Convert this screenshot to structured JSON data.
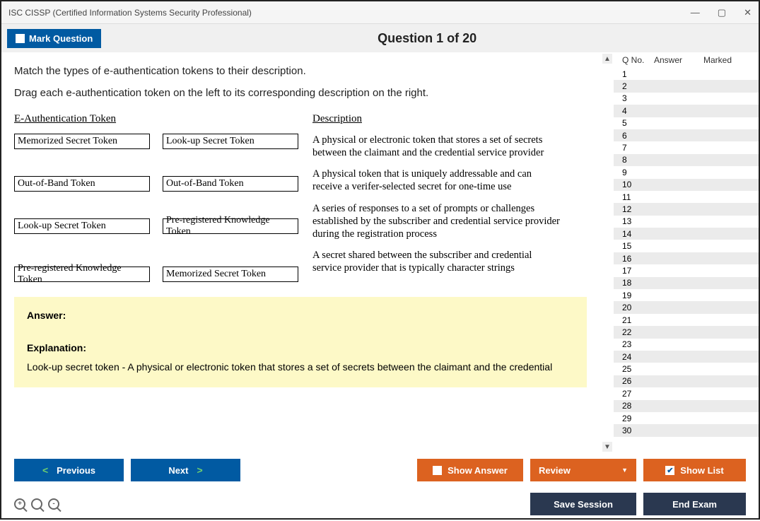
{
  "window": {
    "title": "ISC CISSP (Certified Information Systems Security Professional)"
  },
  "header": {
    "mark_label": "Mark Question",
    "question_title": "Question 1 of 20"
  },
  "prompt": {
    "line1": "Match the types of e-authentication tokens to their description.",
    "line2": "Drag each e-authentication token on the left to its corresponding description on the right."
  },
  "columns": {
    "left_head": "E-Authentication Token",
    "right_head": "Description"
  },
  "tokens_left": [
    "Memorized Secret Token",
    "Out-of-Band Token",
    "Look-up Secret Token",
    "Pre-registered Knowledge Token"
  ],
  "tokens_dropped": [
    "Look-up Secret Token",
    "Out-of-Band Token",
    "Pre-registered Knowledge Token",
    "Memorized Secret Token"
  ],
  "descriptions": [
    "A physical or electronic token that stores a set of secrets between the claimant and the credential service provider",
    "A physical token that is uniquely addressable and can receive a verifer-selected secret for one-time use",
    "A series of responses to a set of prompts or challenges established by the subscriber and credential service provider during the registration process",
    "A secret shared between the subscriber and credential service provider that is typically character strings"
  ],
  "answer_panel": {
    "answer_label": "Answer:",
    "explanation_label": "Explanation:",
    "explanation_text": "Look-up secret token - A physical or electronic token that stores a set of secrets between the claimant and the credential"
  },
  "qlist": {
    "head_qno": "Q No.",
    "head_answer": "Answer",
    "head_marked": "Marked",
    "rows": [
      1,
      2,
      3,
      4,
      5,
      6,
      7,
      8,
      9,
      10,
      11,
      12,
      13,
      14,
      15,
      16,
      17,
      18,
      19,
      20,
      21,
      22,
      23,
      24,
      25,
      26,
      27,
      28,
      29,
      30
    ]
  },
  "footer": {
    "previous": "Previous",
    "next": "Next",
    "show_answer": "Show Answer",
    "review": "Review",
    "show_list": "Show List",
    "save_session": "Save Session",
    "end_exam": "End Exam"
  }
}
